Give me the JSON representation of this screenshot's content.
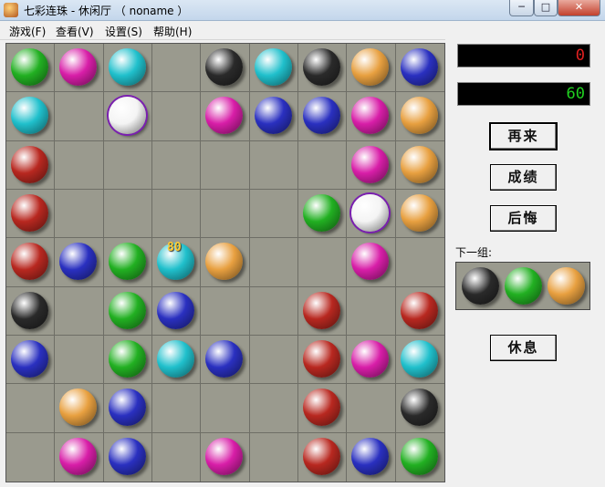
{
  "window": {
    "title": "七彩连珠 - 休闲厅 （ noname ）",
    "minimize_glyph": "─",
    "maximize_glyph": "□",
    "close_glyph": "✕"
  },
  "menu": [
    {
      "label": "游戏(F)"
    },
    {
      "label": "查看(V)"
    },
    {
      "label": "设置(S)"
    },
    {
      "label": "帮助(H)"
    }
  ],
  "colors": {
    "green": "#22b022",
    "magenta": "#d81ea8",
    "cyan": "#20c0cc",
    "black": "#2a2a2a",
    "orange": "#e8a040",
    "blue": "#2a30c0",
    "white": "#f4f4f4",
    "red": "#b82820"
  },
  "board": {
    "rows": 9,
    "cols": 9,
    "grid": [
      [
        "green",
        "magenta",
        "cyan",
        "",
        "black",
        "cyan",
        "black",
        "orange",
        "blue"
      ],
      [
        "cyan",
        "",
        "white",
        "",
        "magenta",
        "blue",
        "blue",
        "magenta",
        "orange"
      ],
      [
        "red",
        "",
        "",
        "",
        "",
        "",
        "",
        "magenta",
        "orange"
      ],
      [
        "red",
        "",
        "",
        "",
        "",
        "",
        "green",
        "white",
        "orange"
      ],
      [
        "red",
        "blue",
        "green",
        "cyan",
        "orange",
        "",
        "",
        "magenta",
        ""
      ],
      [
        "black",
        "",
        "green",
        "blue",
        "",
        "",
        "red",
        "",
        "red"
      ],
      [
        "blue",
        "",
        "green",
        "cyan",
        "blue",
        "",
        "red",
        "magenta",
        "cyan"
      ],
      [
        "",
        "orange",
        "blue",
        "",
        "",
        "",
        "red",
        "",
        "black"
      ],
      [
        "",
        "magenta",
        "blue",
        "",
        "magenta",
        "",
        "red",
        "blue",
        "green"
      ]
    ],
    "selected": [
      [
        1,
        2
      ],
      [
        3,
        7
      ]
    ],
    "score_popup": "80"
  },
  "sidebar": {
    "score": "0",
    "time": "60",
    "again_label": "再来",
    "records_label": "成绩",
    "undo_label": "后悔",
    "next_label": "下一组:",
    "next_balls": [
      "black",
      "green",
      "orange"
    ],
    "rest_label": "休息"
  }
}
